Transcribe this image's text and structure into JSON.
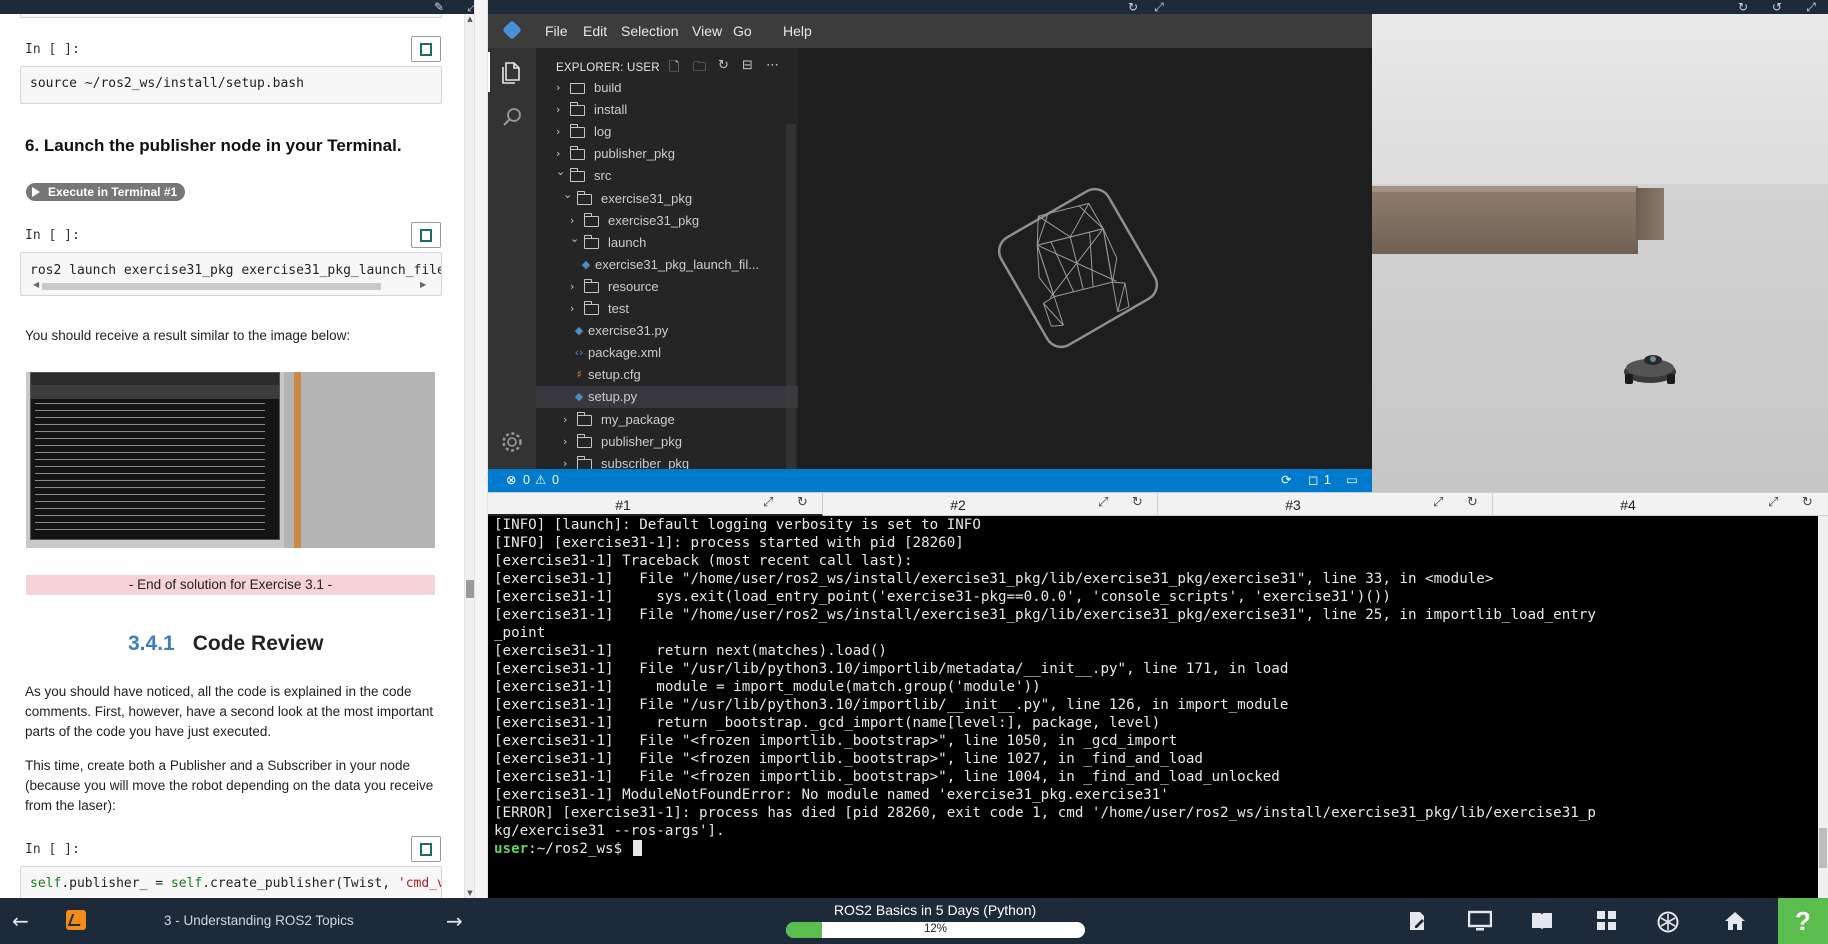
{
  "notebook": {
    "prompt_label": "In [ ]:",
    "cell1_code": "source ~/ros2_ws/install/setup.bash",
    "heading_step6": "6. Launch the publisher node in your Terminal.",
    "exec_badge": "Execute in Terminal #1",
    "cell2_code": "ros2 launch exercise31_pkg exercise31_pkg_launch_file",
    "result_text": "You should receive a result similar to the image below:",
    "end_banner": "- End of solution for Exercise 3.1 -",
    "section_number": "3.4.1",
    "section_title": "Code Review",
    "para1": "As you should have noticed, all the code is explained in the code comments. First, however, have a second look at the most important parts of the code you have just executed.",
    "para2": "This time, create both a Publisher and a Subscriber in your node (because you will move the robot depending on the data you receive from the laser):",
    "cell3_code_parts": [
      "self",
      ".publisher_ = ",
      "self",
      ".create_publisher(Twist, ",
      "'cmd_v"
    ]
  },
  "vscode": {
    "menu": [
      "File",
      "Edit",
      "Selection",
      "View",
      "Go",
      "Help"
    ],
    "explorer_title": "EXPLORER: USER",
    "tree": [
      {
        "label": "build",
        "kind": "folder",
        "depth": 0,
        "open": false
      },
      {
        "label": "install",
        "kind": "folder",
        "depth": 0,
        "open": false
      },
      {
        "label": "log",
        "kind": "folder",
        "depth": 0,
        "open": false
      },
      {
        "label": "publisher_pkg",
        "kind": "folder",
        "depth": 0,
        "open": false
      },
      {
        "label": "src",
        "kind": "folder",
        "depth": 0,
        "open": true
      },
      {
        "label": "exercise31_pkg",
        "kind": "folder",
        "depth": 1,
        "open": true
      },
      {
        "label": "exercise31_pkg",
        "kind": "folder",
        "depth": 2,
        "open": false
      },
      {
        "label": "launch",
        "kind": "folder",
        "depth": 2,
        "open": true
      },
      {
        "label": "exercise31_pkg_launch_fil...",
        "kind": "py",
        "depth": 3
      },
      {
        "label": "resource",
        "kind": "folder",
        "depth": 2,
        "open": false
      },
      {
        "label": "test",
        "kind": "folder",
        "depth": 2,
        "open": false
      },
      {
        "label": "exercise31.py",
        "kind": "py",
        "depth": 2
      },
      {
        "label": "package.xml",
        "kind": "xml",
        "depth": 2
      },
      {
        "label": "setup.cfg",
        "kind": "cfg",
        "depth": 2
      },
      {
        "label": "setup.py",
        "kind": "py",
        "depth": 2,
        "selected": true
      },
      {
        "label": "my_package",
        "kind": "folder",
        "depth": 1,
        "open": false
      },
      {
        "label": "publisher_pkg",
        "kind": "folder",
        "depth": 1,
        "open": false
      },
      {
        "label": "subscriber_pkg",
        "kind": "folder",
        "depth": 1,
        "open": false
      }
    ],
    "status_errors": "0",
    "status_warnings": "0",
    "status_right_count": "1"
  },
  "terminal": {
    "tabs": [
      "#1",
      "#2",
      "#3",
      "#4"
    ],
    "active_tab": 0,
    "lines": [
      "[INFO] [launch]: Default logging verbosity is set to INFO",
      "[INFO] [exercise31-1]: process started with pid [28260]",
      "[exercise31-1] Traceback (most recent call last):",
      "[exercise31-1]   File \"/home/user/ros2_ws/install/exercise31_pkg/lib/exercise31_pkg/exercise31\", line 33, in <module>",
      "[exercise31-1]     sys.exit(load_entry_point('exercise31-pkg==0.0.0', 'console_scripts', 'exercise31')())",
      "[exercise31-1]   File \"/home/user/ros2_ws/install/exercise31_pkg/lib/exercise31_pkg/exercise31\", line 25, in importlib_load_entry",
      "_point",
      "[exercise31-1]     return next(matches).load()",
      "[exercise31-1]   File \"/usr/lib/python3.10/importlib/metadata/__init__.py\", line 171, in load",
      "[exercise31-1]     module = import_module(match.group('module'))",
      "[exercise31-1]   File \"/usr/lib/python3.10/importlib/__init__.py\", line 126, in import_module",
      "[exercise31-1]     return _bootstrap._gcd_import(name[level:], package, level)",
      "[exercise31-1]   File \"<frozen importlib._bootstrap>\", line 1050, in _gcd_import",
      "[exercise31-1]   File \"<frozen importlib._bootstrap>\", line 1027, in _find_and_load",
      "[exercise31-1]   File \"<frozen importlib._bootstrap>\", line 1004, in _find_and_load_unlocked",
      "[exercise31-1] ModuleNotFoundError: No module named 'exercise31_pkg.exercise31'",
      "[ERROR] [exercise31-1]: process has died [pid 28260, exit code 1, cmd '/home/user/ros2_ws/install/exercise31_pkg/lib/exercise31_p",
      "kg/exercise31 --ros-args']."
    ],
    "prompt_user": "user",
    "prompt_path": ":~/ros2_ws$ "
  },
  "bottombar": {
    "unit_title": "3 - Understanding ROS2 Topics",
    "course_title": "ROS2 Basics in 5 Days (Python)",
    "progress_text": "12%",
    "progress_value": 0.12,
    "help_label": "?"
  },
  "colors": {
    "accent_green": "#5bbd4d",
    "vscode_status": "#007acc",
    "section_number_blue": "#3c7fbf"
  }
}
